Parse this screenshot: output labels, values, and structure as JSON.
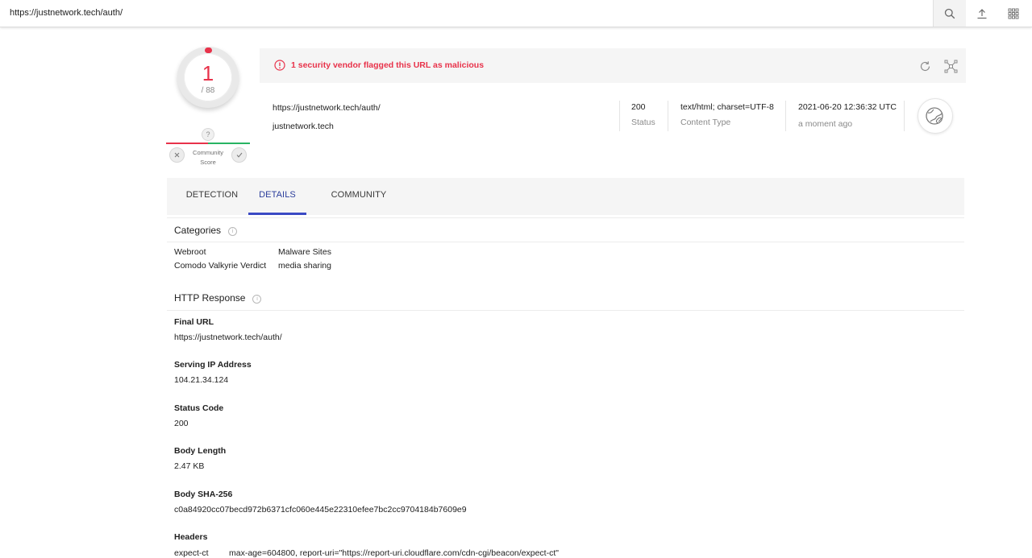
{
  "search": {
    "value": "https://justnetwork.tech/auth/"
  },
  "score": {
    "detections": "1",
    "total": "/ 88",
    "color": "#e8324a"
  },
  "community": {
    "unknown_glyph": "?",
    "label_line1": "Community",
    "label_line2": "Score"
  },
  "alert": {
    "text": "1 security vendor flagged this URL as malicious",
    "color": "#e8324a"
  },
  "summary": {
    "url": "https://justnetwork.tech/auth/",
    "domain": "justnetwork.tech",
    "status_value": "200",
    "status_label": "Status",
    "content_type_value": "text/html; charset=UTF-8",
    "content_type_label": "Content Type",
    "date_value": "2021-06-20 12:36:32 UTC",
    "date_relative": "a moment ago"
  },
  "tabs": [
    {
      "label": "DETECTION",
      "active": false
    },
    {
      "label": "DETAILS",
      "active": true
    },
    {
      "label": "COMMUNITY",
      "active": false
    }
  ],
  "categories": {
    "title": "Categories",
    "rows": [
      {
        "vendor": "Webroot",
        "category": "Malware Sites"
      },
      {
        "vendor": "Comodo Valkyrie Verdict",
        "category": "media sharing"
      }
    ]
  },
  "http": {
    "title": "HTTP Response",
    "final_url_label": "Final URL",
    "final_url": "https://justnetwork.tech/auth/",
    "ip_label": "Serving IP Address",
    "ip": "104.21.34.124",
    "status_code_label": "Status Code",
    "status_code": "200",
    "body_length_label": "Body Length",
    "body_length": "2.47 KB",
    "sha_label": "Body SHA-256",
    "sha": "c0a84920cc07becd972b6371cfc060e445e22310efee7bc2cc9704184b7609e9",
    "headers_label": "Headers",
    "header_key": "expect-ct",
    "header_value": "max-age=604800, report-uri=\"https://report-uri.cloudflare.com/cdn-cgi/beacon/expect-ct\""
  },
  "icons": {
    "search": "search-icon",
    "upload": "upload-icon",
    "apps": "apps-grid-icon",
    "alert": "alert-circle-icon",
    "refresh": "refresh-icon",
    "graph": "graph-icon",
    "site": "globe-link-icon",
    "vote_down": "close-icon",
    "vote_up": "check-icon"
  }
}
